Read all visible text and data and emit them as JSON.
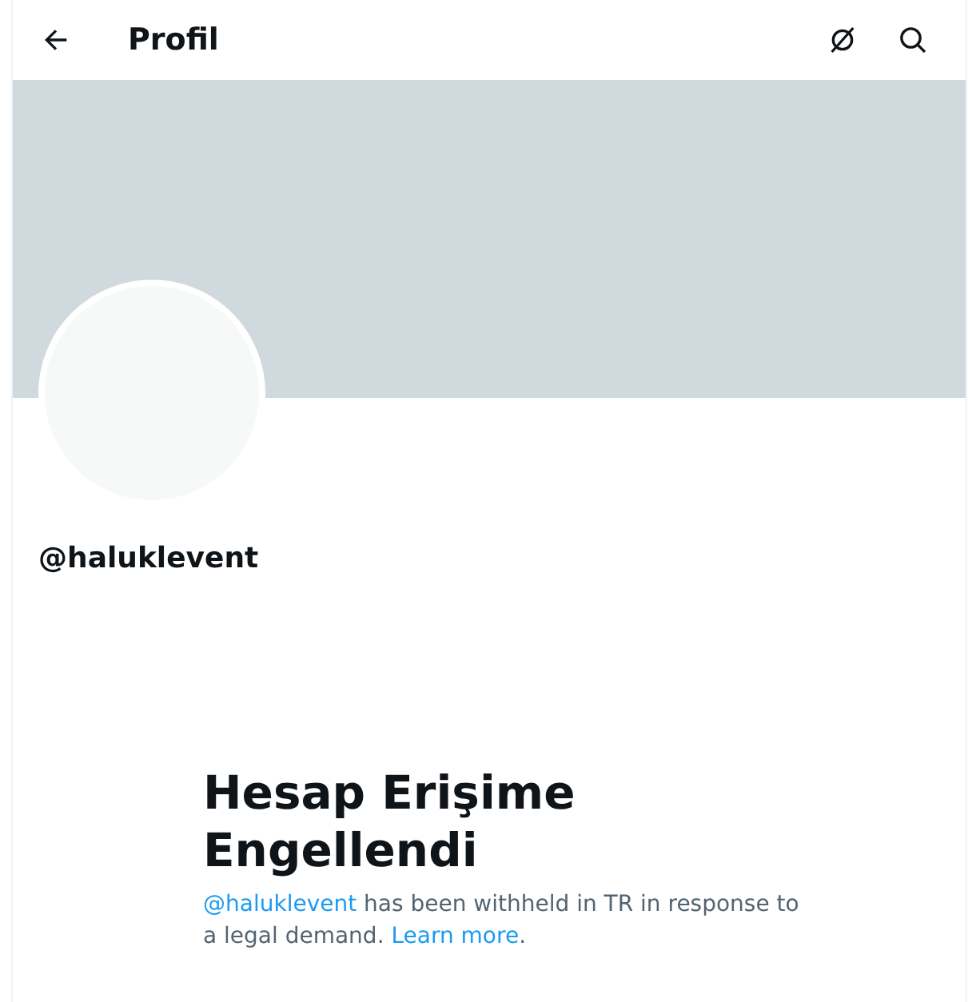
{
  "header": {
    "title": "Profil"
  },
  "profile": {
    "username": "@haluklevent"
  },
  "notice": {
    "title": "Hesap Erişime Engellendi",
    "message": [
      {
        "kind": "link",
        "text": "@haluklevent"
      },
      {
        "kind": "text",
        "text": " has been withheld in TR in response to a legal demand. "
      },
      {
        "kind": "link",
        "text": "Learn more"
      },
      {
        "kind": "text",
        "text": "."
      }
    ]
  }
}
